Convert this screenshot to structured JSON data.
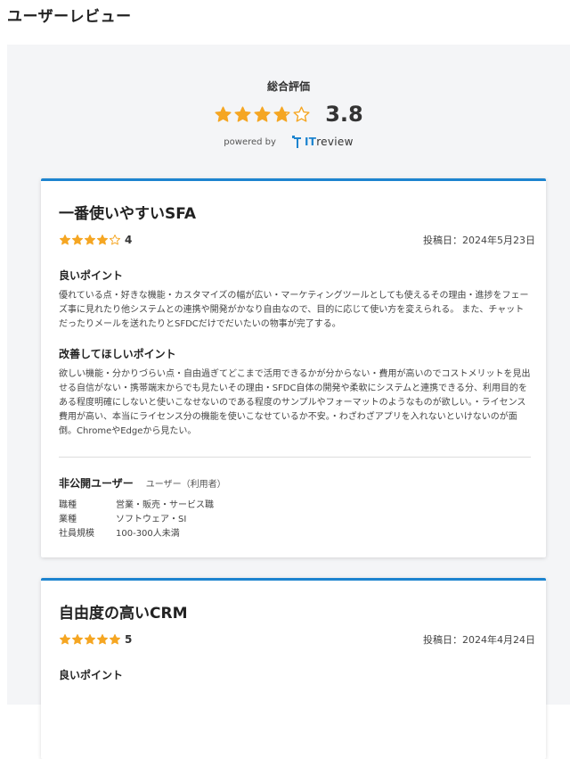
{
  "page": {
    "title": "ユーザーレビュー"
  },
  "summary": {
    "label": "総合評価",
    "score": "3.8",
    "rating_value": 3.8,
    "rating_max": 5,
    "powered_by": "powered by",
    "logo_prefix": "IT",
    "logo_suffix": "review"
  },
  "reviews": [
    {
      "title": "一番使いやすいSFA",
      "rating": "4",
      "rating_value": 4,
      "date": "投稿日：2024年5月23日",
      "good_head": "良いポイント",
      "good_body": "優れている点・好きな機能・カスタマイズの幅が広い・マーケティングツールとしても使えるその理由・進捗をフェーズ事に見れたり他システムとの連携や開発がかなり自由なので、目的に応じて使い方を変えられる。 また、チャットだったりメールを送れたりとSFDCだけでだいたいの物事が完了する。",
      "improve_head": "改善してほしいポイント",
      "improve_body": "欲しい機能・分かりづらい点・自由過ぎてどこまで活用できるかが分からない・費用が高いのでコストメリットを見出せる自信がない・携帯端末からでも見たいその理由・SFDC自体の開発や柔軟にシステムと連携できる分、利用目的をある程度明確にしないと使いこなせないのである程度のサンプルやフォーマットのようなものが欲しい。・ライセンス費用が高い、本当にライセンス分の機能を使いこなせているか不安。・わざわざアプリを入れないといけないのが面倒。ChromeやEdgeから見たい。",
      "reviewer_name": "非公開ユーザー",
      "reviewer_role": "ユーザー（利用者）",
      "meta": [
        {
          "key": "職種",
          "value": "営業・販売・サービス職"
        },
        {
          "key": "業種",
          "value": "ソフトウェア・SI"
        },
        {
          "key": "社員規模",
          "value": "100-300人未満"
        }
      ]
    },
    {
      "title": "自由度の高いCRM",
      "rating": "5",
      "rating_value": 5,
      "date": "投稿日：2024年4月24日",
      "good_head": "良いポイント"
    }
  ],
  "colors": {
    "accent": "#1d84cf",
    "star": "#f5a623",
    "background": "#f4f5f7"
  },
  "icons": {
    "star": "star-icon",
    "logo": "itreview-logo-icon"
  }
}
